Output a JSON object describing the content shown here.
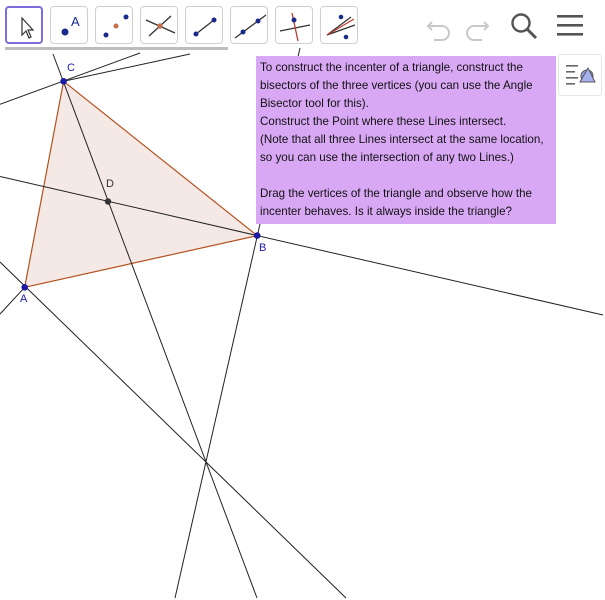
{
  "toolbar": {
    "tools": [
      {
        "name": "move-tool",
        "icon": "arrow-pointer-icon",
        "selected": true
      },
      {
        "name": "point-tool",
        "icon": "point-with-label-icon",
        "label": "A"
      },
      {
        "name": "midpoint-tool",
        "icon": "midpoint-icon"
      },
      {
        "name": "intersect-tool",
        "icon": "intersect-icon"
      },
      {
        "name": "segment-tool",
        "icon": "segment-icon"
      },
      {
        "name": "line-tool",
        "icon": "line-icon"
      },
      {
        "name": "perpendicular-line-tool",
        "icon": "perpendicular-line-icon"
      },
      {
        "name": "angle-bisector-tool",
        "icon": "angle-bisector-icon"
      }
    ],
    "right_icons": [
      "undo-icon",
      "redo-icon",
      "search-icon",
      "menu-icon"
    ]
  },
  "task": {
    "lines": [
      "To construct the incenter of a triangle, construct the",
      "bisectors of the three vertices (you can use the Angle",
      "Bisector tool for this).",
      "Construct the Point where these Lines intersect.",
      "(Note that all three Lines intersect at the same location,",
      "so you can use the intersection of any two Lines.)",
      "",
      "Drag the vertices of the triangle and observe how the",
      "incenter behaves. Is it always inside the triangle?"
    ]
  },
  "points": {
    "A": "A",
    "B": "B",
    "C": "C",
    "D": "D"
  },
  "colors": {
    "triangle_fill": "#f4e9e4",
    "triangle_stroke": "#b5501e",
    "task_bg": "#d9a8f5",
    "point": "#1a1aa6",
    "accent": "#7e6bdc"
  }
}
